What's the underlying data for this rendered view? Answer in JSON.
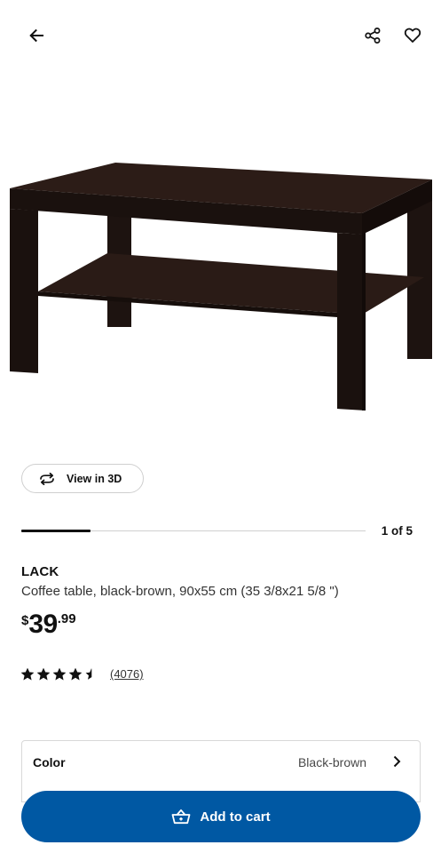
{
  "header": {
    "back_icon": "arrow-left-icon",
    "share_icon": "share-icon",
    "favorite_icon": "heart-icon"
  },
  "gallery": {
    "view3d_label": "View in 3D",
    "view3d_icon": "rotate-3d-icon",
    "pager": "1 of 5",
    "current_image": 1,
    "total_images": 5
  },
  "product": {
    "name": "LACK",
    "description": "Coffee table, black-brown, 90x55 cm (35 3/8x21 5/8 \")",
    "price": {
      "currency": "$",
      "integer": "39",
      "decimal": ".99"
    },
    "rating": {
      "stars": 4.5,
      "max_stars": 5,
      "review_count": "(4076)"
    }
  },
  "color_selector": {
    "label": "Color",
    "value": "Black-brown",
    "chevron_icon": "chevron-right-icon"
  },
  "cart": {
    "label": "Add to cart",
    "icon": "basket-icon",
    "accent": "#0058a3"
  },
  "colors": {
    "table_wood": "#231612",
    "text_primary": "#111111",
    "brand_blue": "#0058a3"
  }
}
